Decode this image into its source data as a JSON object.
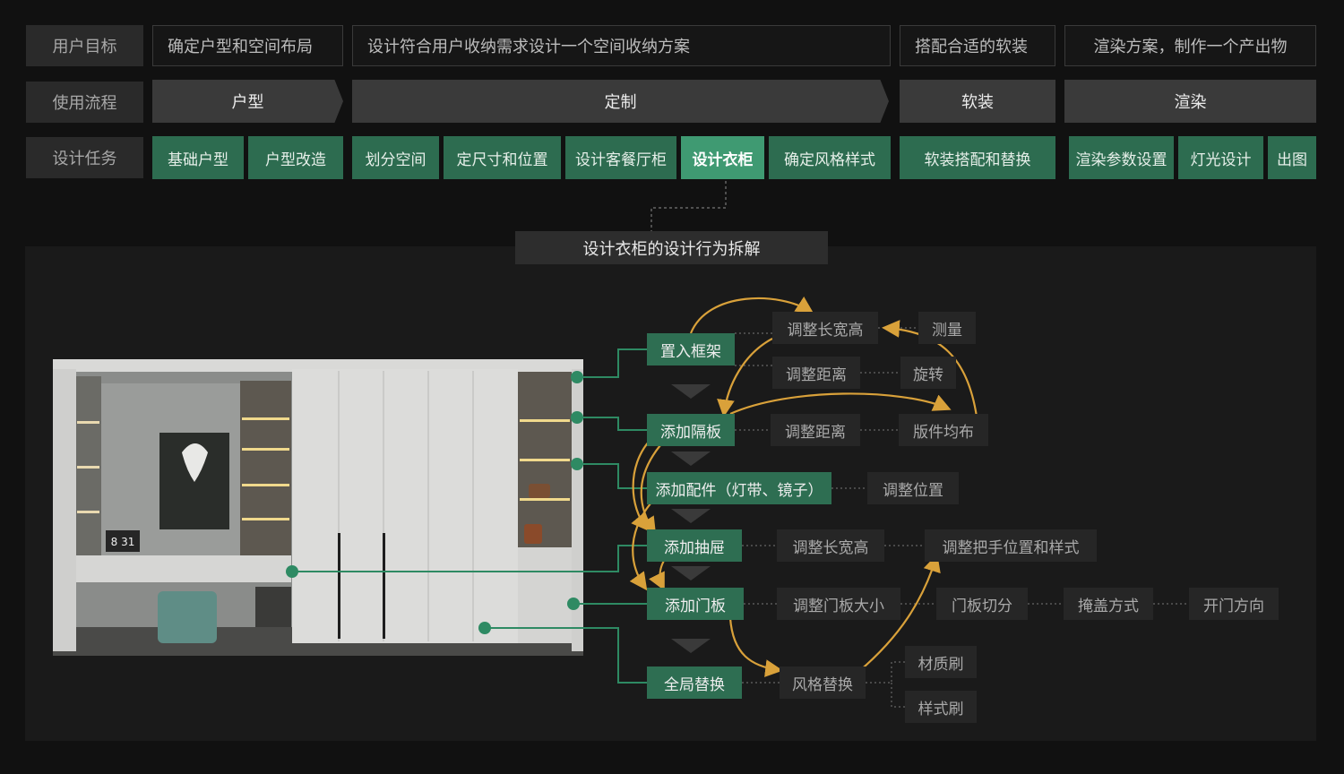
{
  "rows": {
    "goal": {
      "label": "用户目标",
      "items": [
        "确定户型和空间布局",
        "设计符合用户收纳需求设计一个空间收纳方案",
        "搭配合适的软装",
        "渲染方案，制作一个产出物"
      ]
    },
    "flow": {
      "label": "使用流程",
      "items": [
        "户型",
        "定制",
        "软装",
        "渲染"
      ]
    },
    "tasks": {
      "label": "设计任务",
      "items": [
        "基础户型",
        "户型改造",
        "划分空间",
        "定尺寸和位置",
        "设计客餐厅柜",
        "设计衣柜",
        "确定风格样式",
        "软装搭配和替换",
        "渲染参数设置",
        "灯光设计",
        "出图"
      ],
      "active": "设计衣柜"
    }
  },
  "breakdown": {
    "title": "设计衣柜的设计行为拆解",
    "steps": [
      "置入框架",
      "添加隔板",
      "添加配件（灯带、镜子）",
      "添加抽屉",
      "添加门板",
      "全局替换"
    ],
    "details": {
      "frame": [
        "调整长宽高",
        "测量",
        "调整距离",
        "旋转"
      ],
      "shelf": [
        "调整距离",
        "版件均布"
      ],
      "accessory": [
        "调整位置"
      ],
      "drawer": [
        "调整长宽高",
        "调整把手位置和样式"
      ],
      "door": [
        "调整门板大小",
        "门板切分",
        "掩盖方式",
        "开门方向"
      ],
      "global": [
        "风格替换",
        "材质刷",
        "样式刷"
      ]
    },
    "clock_text": "8 31"
  },
  "colors": {
    "green": "#2e6e52",
    "active_green": "#3f9a72",
    "arrow_orange": "#d9a13a",
    "dark_box": "#262626"
  }
}
